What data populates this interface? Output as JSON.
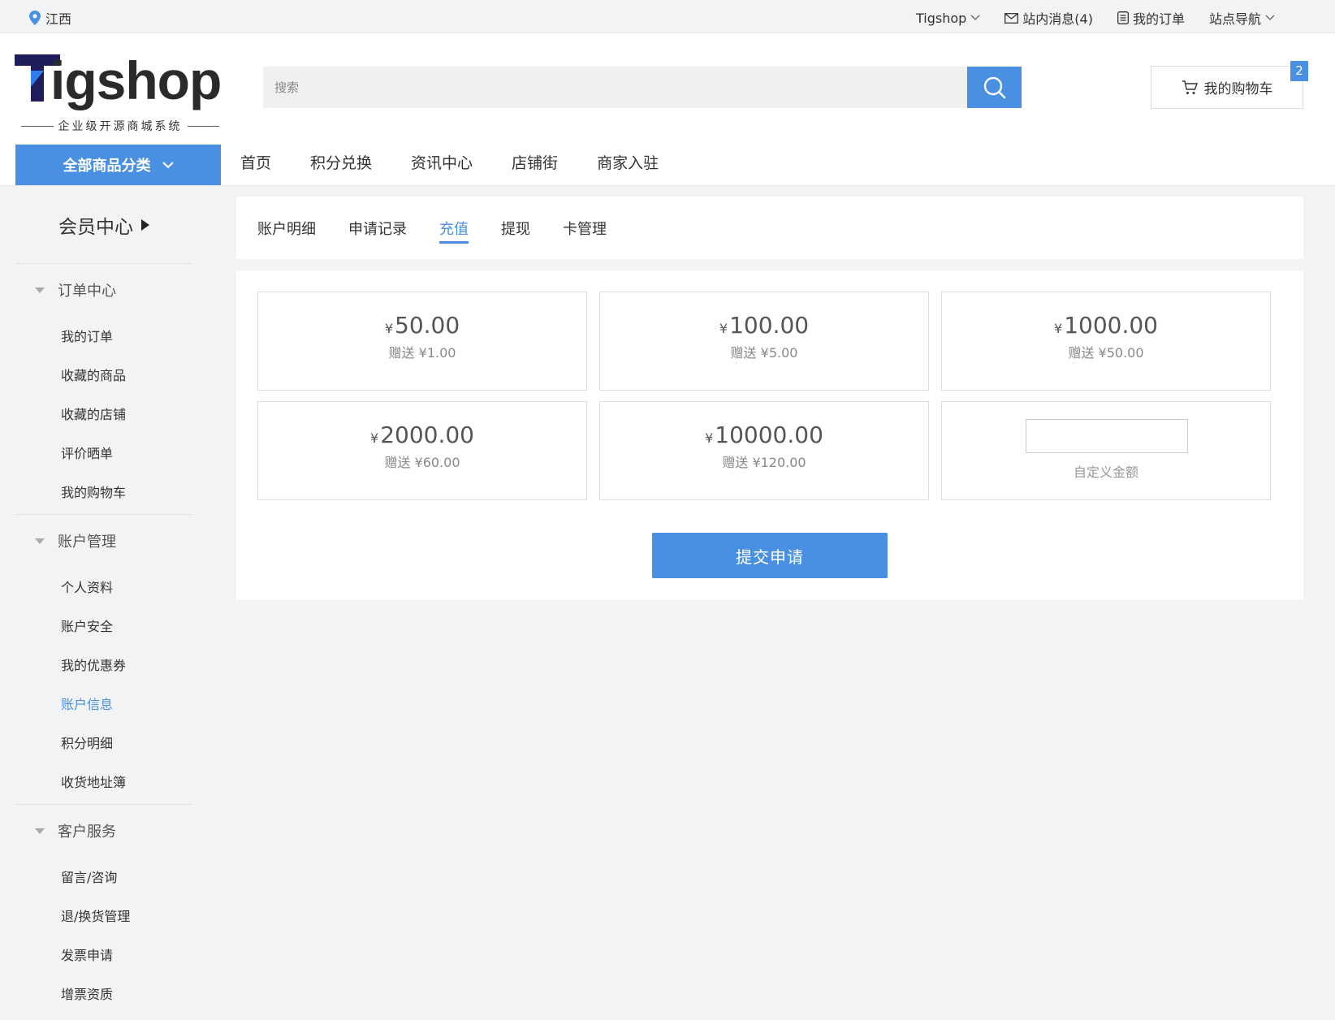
{
  "topbar": {
    "location": "江西",
    "nav": [
      {
        "label": "Tigshop",
        "icon": "chevron-down-icon"
      },
      {
        "label": "站内消息(4)",
        "icon": "mail-icon"
      },
      {
        "label": "我的订单",
        "icon": "document-icon"
      },
      {
        "label": "站点导航",
        "icon": "chevron-down-icon"
      }
    ]
  },
  "header": {
    "logo_text": "Tigshop",
    "logo_sub": "企业级开源商城系统",
    "search_placeholder": "搜索",
    "cart_label": "我的购物车",
    "cart_count": "2",
    "category_button": "全部商品分类",
    "main_nav": [
      "首页",
      "积分兑换",
      "资讯中心",
      "店铺街",
      "商家入驻"
    ]
  },
  "sidebar": {
    "title": "会员中心",
    "groups": [
      {
        "title": "订单中心",
        "items": [
          "我的订单",
          "收藏的商品",
          "收藏的店铺",
          "评价晒单",
          "我的购物车"
        ]
      },
      {
        "title": "账户管理",
        "items": [
          "个人资料",
          "账户安全",
          "我的优惠券",
          "账户信息",
          "积分明细",
          "收货地址簿"
        ]
      },
      {
        "title": "客户服务",
        "items": [
          "留言/咨询",
          "退/换货管理",
          "发票申请",
          "增票资质"
        ]
      }
    ],
    "active_item": "账户信息"
  },
  "tabs": {
    "items": [
      "账户明细",
      "申请记录",
      "充值",
      "提现",
      "卡管理"
    ],
    "active": "充值"
  },
  "recharge": {
    "currency": "¥",
    "options": [
      {
        "amount": "50.00",
        "gift": "赠送 ¥1.00"
      },
      {
        "amount": "100.00",
        "gift": "赠送 ¥5.00"
      },
      {
        "amount": "1000.00",
        "gift": "赠送 ¥50.00"
      },
      {
        "amount": "2000.00",
        "gift": "赠送 ¥60.00"
      },
      {
        "amount": "10000.00",
        "gift": "赠送 ¥120.00"
      }
    ],
    "custom_value": "",
    "custom_label": "自定义金额",
    "submit_label": "提交申请"
  },
  "colors": {
    "accent": "#4a90e2",
    "background": "#f2f3f5"
  }
}
